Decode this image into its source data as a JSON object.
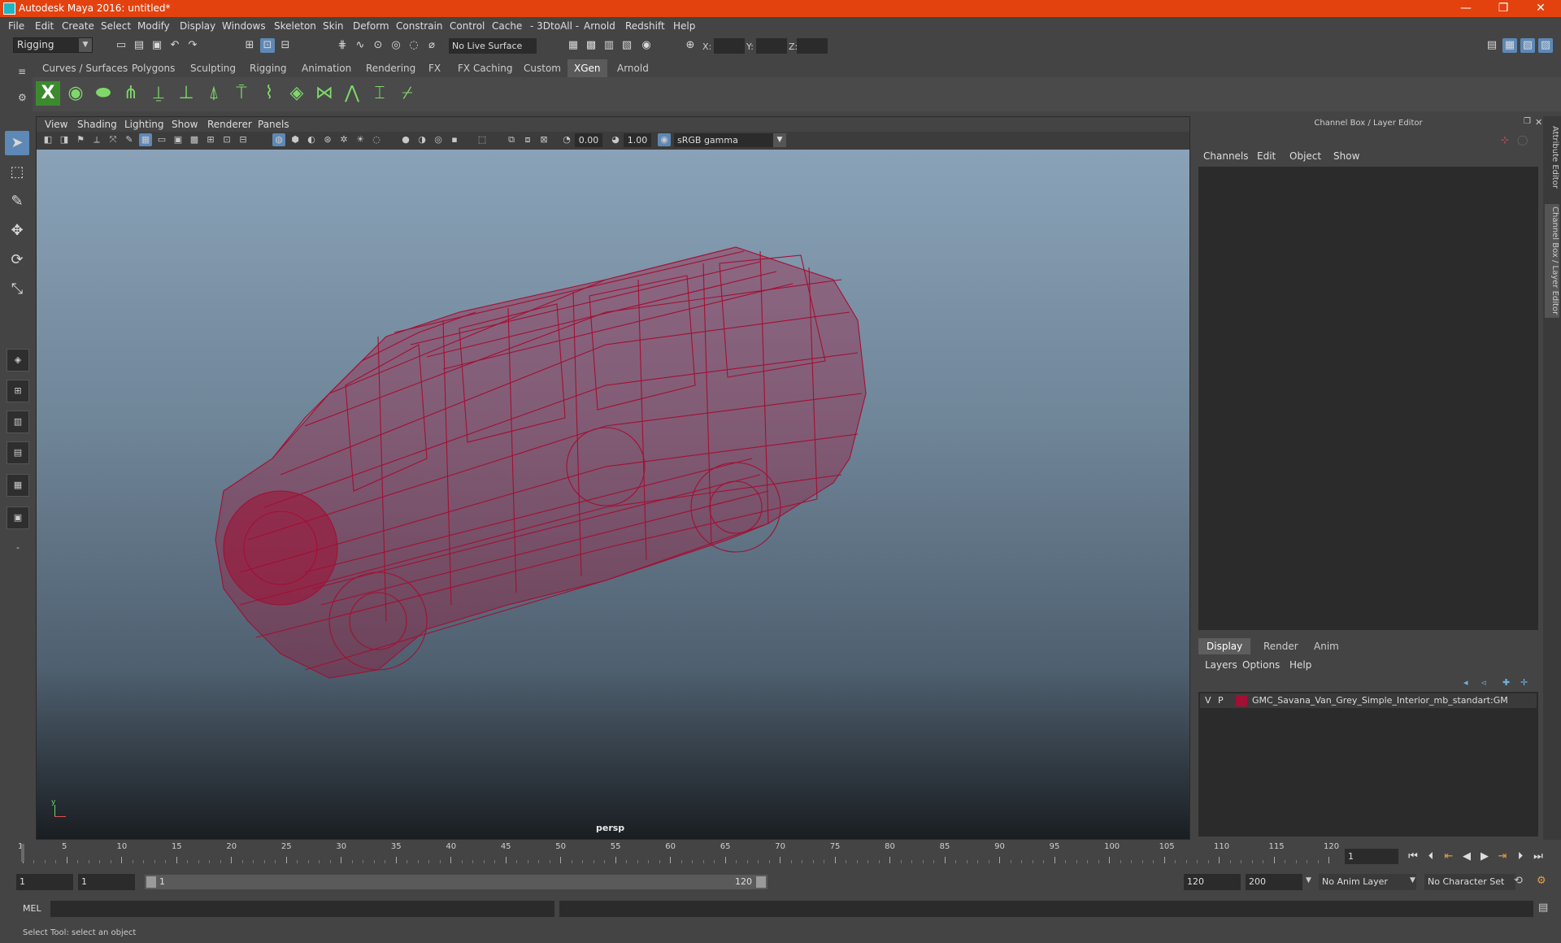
{
  "titlebar": {
    "title": "Autodesk Maya 2016: untitled*",
    "minimize": "—",
    "restore": "❐",
    "close": "✕"
  },
  "menubar": [
    "File",
    "Edit",
    "Create",
    "Select",
    "Modify",
    "Display",
    "Windows",
    "Skeleton",
    "Skin",
    "Deform",
    "Constrain",
    "Control",
    "Cache",
    "- 3DtoAll -",
    "Arnold",
    "Redshift",
    "Help"
  ],
  "statusline": {
    "mode": "Rigging",
    "live_surface": "No Live Surface",
    "x_label": "X:",
    "y_label": "Y:",
    "z_label": "Z:"
  },
  "shelf": {
    "tabs": [
      "Curves / Surfaces",
      "Polygons",
      "Sculpting",
      "Rigging",
      "Animation",
      "Rendering",
      "FX",
      "FX Caching",
      "Custom",
      "XGen",
      "Arnold"
    ],
    "active_tab": "XGen"
  },
  "viewport": {
    "menu": [
      "View",
      "Shading",
      "Lighting",
      "Show",
      "Renderer",
      "Panels"
    ],
    "exposure": "0.00",
    "gamma": "1.00",
    "color_space": "sRGB gamma",
    "camera_label": "persp",
    "wire_color": "#a30f34"
  },
  "right_panel": {
    "header": "Channel Box / Layer Editor",
    "menu": [
      "Channels",
      "Edit",
      "Object",
      "Show"
    ],
    "layer_tabs": [
      "Display",
      "Render",
      "Anim"
    ],
    "layer_menu": [
      "Layers",
      "Options",
      "Help"
    ],
    "layer": {
      "v": "V",
      "p": "P",
      "name": "GMC_Savana_Van_Grey_Simple_Interior_mb_standart:GM"
    },
    "side_tabs": [
      "Attribute Editor",
      "Channel Box / Layer Editor"
    ]
  },
  "timeline": {
    "ticks": [
      "1",
      "5",
      "10",
      "15",
      "20",
      "25",
      "30",
      "35",
      "40",
      "45",
      "50",
      "55",
      "60",
      "65",
      "70",
      "75",
      "80",
      "85",
      "90",
      "95",
      "100",
      "105",
      "110",
      "115",
      "120"
    ],
    "current_frame": "1"
  },
  "range": {
    "start": "1",
    "playback_start": "1",
    "slider_start": "1",
    "slider_end": "120",
    "playback_end": "120",
    "end": "200",
    "anim_layer": "No Anim Layer",
    "character_set": "No Character Set"
  },
  "cmdline": {
    "label": "MEL"
  },
  "helpline": {
    "text": "Select Tool: select an object"
  }
}
